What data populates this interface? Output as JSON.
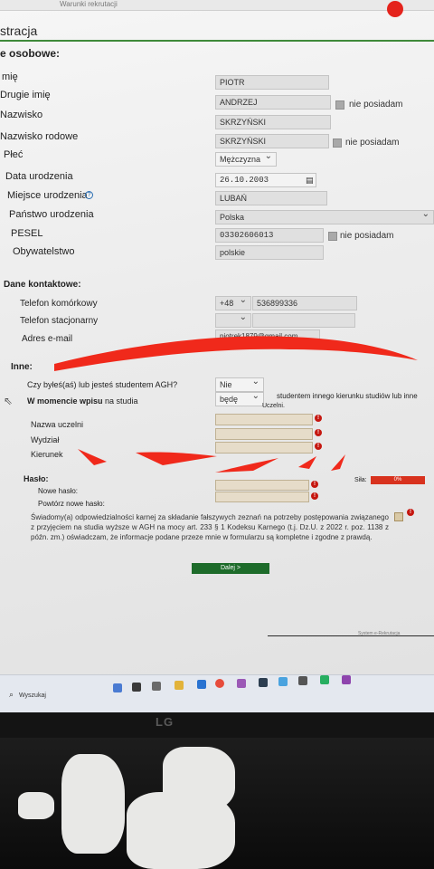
{
  "browser": {
    "tab_label": "Warunki rekrutacji"
  },
  "header": {
    "title": "stracja"
  },
  "personal": {
    "heading": "e osobowe:",
    "first_name": {
      "label": "mię",
      "value": "PIOTR"
    },
    "second_name": {
      "label": "Drugie imię",
      "value": "ANDRZEJ",
      "none_label": "nie posiadam"
    },
    "surname": {
      "label": "Nazwisko",
      "value": "SKRZYŃSKI"
    },
    "family_name": {
      "label": "Nazwisko rodowe",
      "value": "SKRZYŃSKI",
      "none_label": "nie posiadam"
    },
    "sex": {
      "label": "Płeć",
      "value": "Mężczyzna"
    },
    "birth_date": {
      "label": "Data urodzenia",
      "value": "26.10.2003"
    },
    "birth_place": {
      "label": "Miejsce urodzenia",
      "value": "LUBAŃ"
    },
    "birth_country": {
      "label": "Państwo urodzenia",
      "value": "Polska"
    },
    "pesel": {
      "label": "PESEL",
      "value": "03302606013",
      "none_label": "nie posiadam"
    },
    "citizenship": {
      "label": "Obywatelstwo",
      "value": "polskie"
    }
  },
  "contact": {
    "heading": "Dane kontaktowe:",
    "mobile": {
      "label": "Telefon komórkowy",
      "prefix": "+48",
      "value": "536899336"
    },
    "landline": {
      "label": "Telefon stacjonarny",
      "prefix": "",
      "value": ""
    },
    "email": {
      "label": "Adres e-mail",
      "value": "piotrek1879@gmail.com"
    }
  },
  "other": {
    "heading": "Inne:",
    "was_student": {
      "label": "Czy byłeś(aś) lub jesteś studentem AGH?",
      "value": "Nie"
    },
    "enrollment": {
      "label_bold": "W momencie wpisu",
      "label_rest": "na studia",
      "value": "będę",
      "suffix": "studentem innego kierunku studiów lub inne",
      "suffix2": "Uczelni."
    },
    "university": {
      "label": "Nazwa uczelni",
      "value": ""
    },
    "faculty": {
      "label": "Wydział",
      "value": ""
    },
    "major": {
      "label": "Kierunek",
      "value": ""
    }
  },
  "password": {
    "heading": "Hasło:",
    "new": {
      "label": "Nowe hasło:",
      "value": ""
    },
    "repeat": {
      "label": "Powtórz nowe hasło:",
      "value": ""
    },
    "strength_label": "Siła:",
    "strength_value": "0%",
    "strength_fraction": 0
  },
  "declaration": {
    "text": "Świadomy(a) odpowiedzialności karnej za składanie fałszywych zeznań na potrzeby postępowania związanego z przyjęciem na studia wyższe w AGH na mocy art. 233 § 1 Kodeksu Karnego (t.j. Dz.U. z 2022 r. poz. 1138 z późn. zm.) oświadczam, że informacje podane przeze mnie w formularzu są kompletne i zgodne z prawdą."
  },
  "actions": {
    "next_label": "Dalej >"
  },
  "footer": {
    "link": "System e-Rekrutacja"
  },
  "taskbar": {
    "search_label": "Wyszukaj"
  },
  "monitor": {
    "brand": "LG"
  },
  "colors": {
    "accent_green": "#3f8a3a",
    "error_red": "#c5170f",
    "scribble_red": "#f0291b",
    "button_green": "#1d6b2a"
  }
}
